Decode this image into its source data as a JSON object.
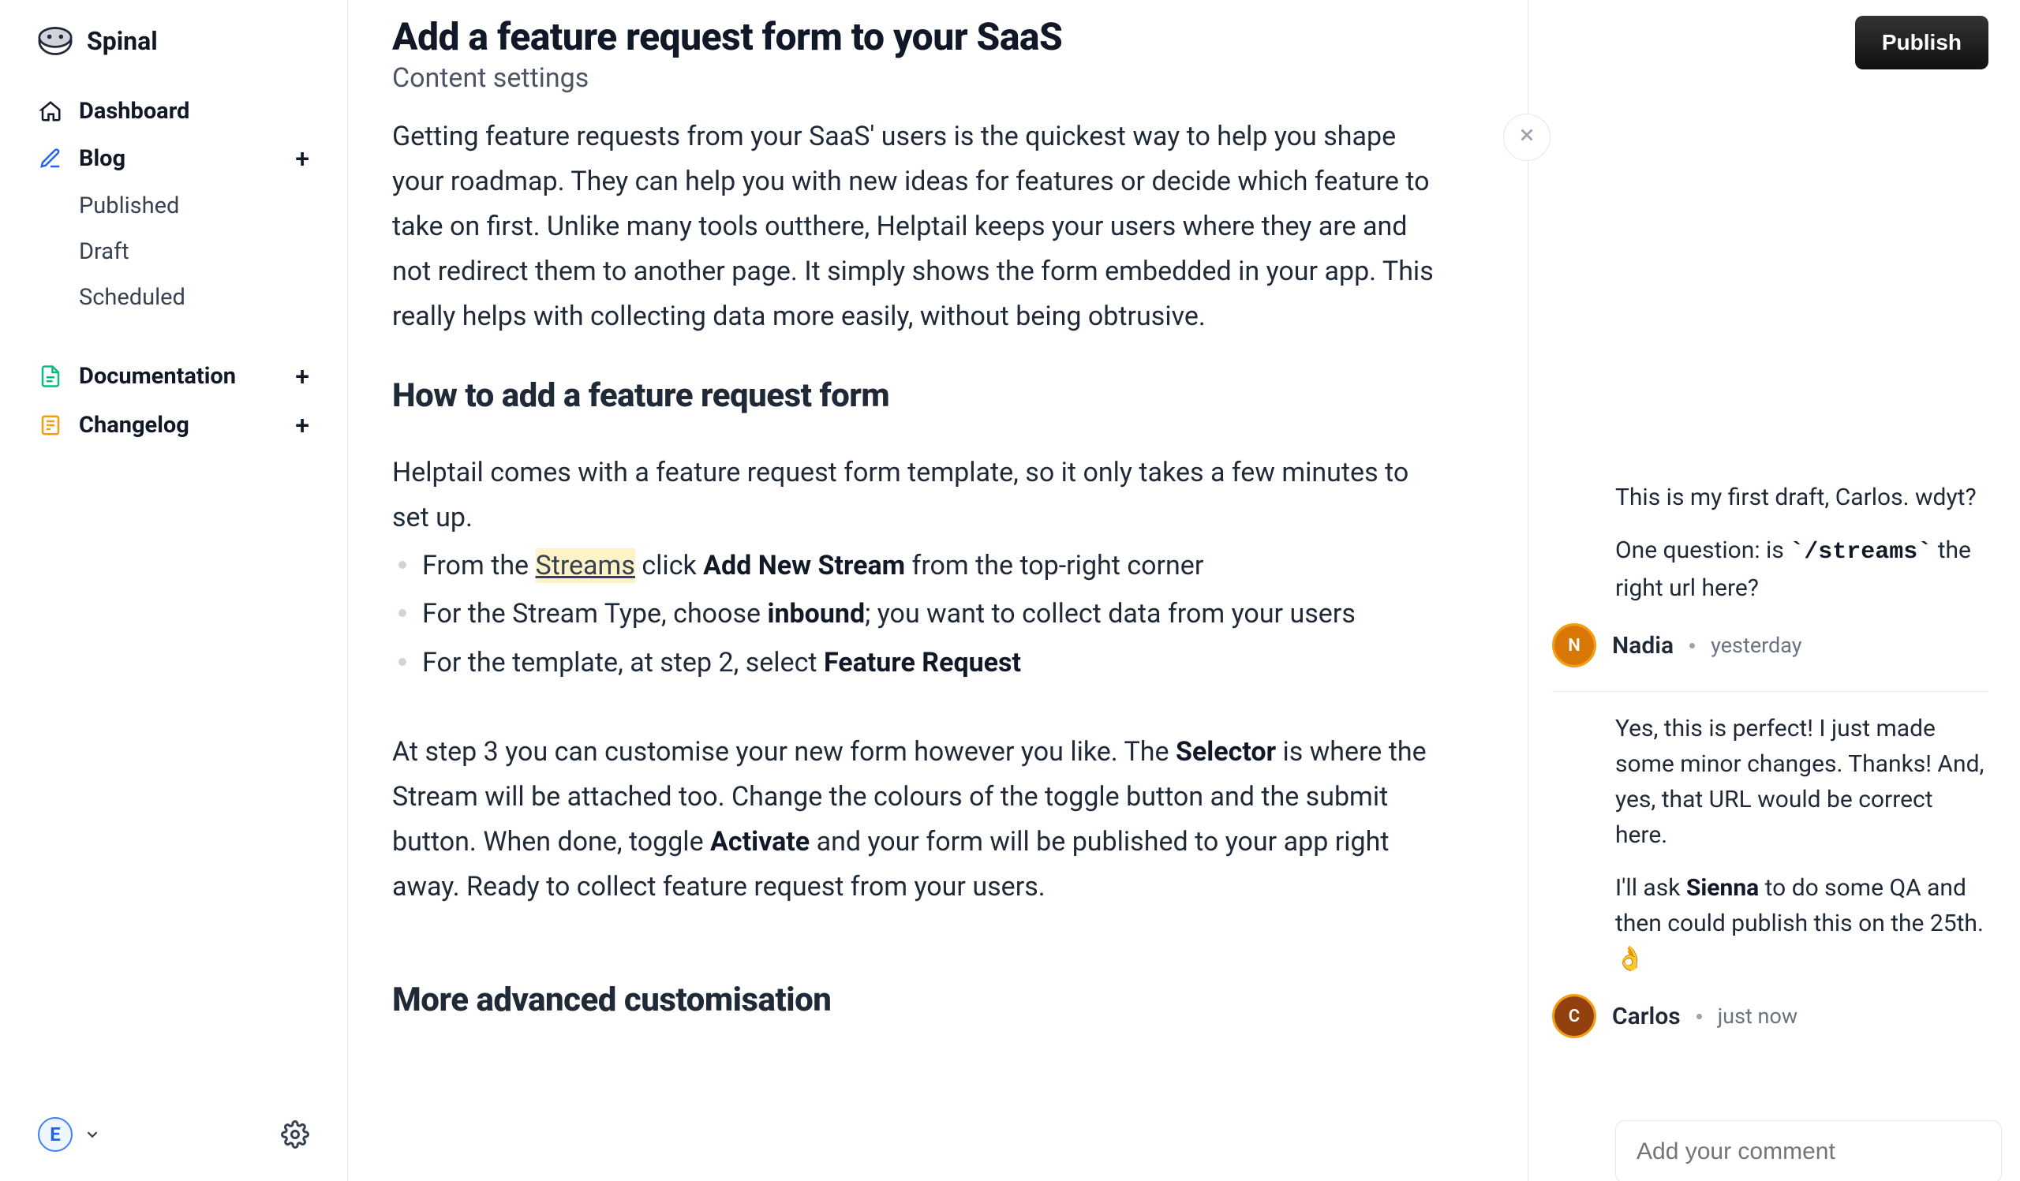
{
  "brand": {
    "name": "Spinal"
  },
  "sidebar": {
    "dashboard": "Dashboard",
    "blog": "Blog",
    "blog_items": [
      "Published",
      "Draft",
      "Scheduled"
    ],
    "documentation": "Documentation",
    "changelog": "Changelog",
    "user_initial": "E"
  },
  "doc": {
    "title": "Add a feature request form to your SaaS",
    "subtitle": "Content settings",
    "intro": "Getting feature requests from your SaaS' users is the quickest way to help you shape your roadmap. They can help you with new ideas for features or decide which feature to take on first. Unlike many tools outthere, Helptail keeps your users where they are and not redirect them to another page. It simply shows the form embedded in your app. This really helps with collecting data more easily, without being obtrusive.",
    "h2_1": "How to add a feature request form",
    "p2": "Helptail comes with a feature request form template, so it only takes a few minutes to set up.",
    "li1_a": "From the ",
    "li1_link": "Streams",
    "li1_b": " click ",
    "li1_strong": "Add New Stream",
    "li1_c": " from the top-right corner",
    "li2_a": "For the Stream Type, choose ",
    "li2_strong": "inbound",
    "li2_b": "; you want to collect data from your users",
    "li3_a": "For the template, at step 2, select ",
    "li3_strong": "Feature Request",
    "p3_a": "At step 3 you can customise your new form however you like. The ",
    "p3_s1": "Selector",
    "p3_b": " is where the Stream will be attached too. Change the colours of the toggle button and the submit button. When done, toggle ",
    "p3_s2": "Activate",
    "p3_c": " and your form will be published to your app right away. Ready to collect feature request from your users.",
    "h2_2": "More advanced customisation"
  },
  "right": {
    "publish": "Publish",
    "comment1_p1": "This is my first draft, Carlos. wdyt?",
    "comment1_p2_a": "One question: is ",
    "comment1_p2_code": "`/streams`",
    "comment1_p2_b": " the right url here?",
    "comment1_author": "Nadia",
    "comment1_time": "yesterday",
    "comment2_p1": "Yes, this is perfect! I just made some minor changes. Thanks! And, yes, that URL would be correct here.",
    "comment2_p2_a": "I'll ask ",
    "comment2_p2_strong": "Sienna",
    "comment2_p2_b": " to do some QA and then could publish this on the 25th. 👌",
    "comment2_author": "Carlos",
    "comment2_time": "just now",
    "input_placeholder": "Add your comment"
  }
}
